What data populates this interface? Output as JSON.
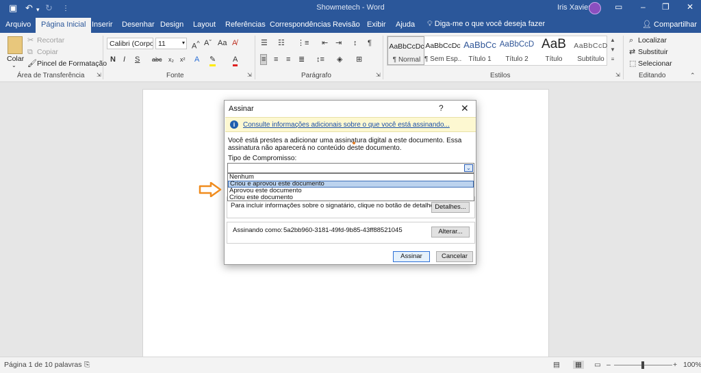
{
  "titlebar": {
    "title": "Showmetech - Word",
    "user": "Iris Xavier",
    "save_icon": "save-icon",
    "undo_icon": "undo-icon",
    "redo_icon": "redo-icon",
    "color_bg": "#2b579a"
  },
  "menubar": {
    "tabs": [
      "Arquivo",
      "Página Inicial",
      "Inserir",
      "Desenhar",
      "Design",
      "Layout",
      "Referências",
      "Correspondências",
      "Revisão",
      "Exibir",
      "Ajuda"
    ],
    "tellme": "Diga-me o que você deseja fazer",
    "share": "Compartilhar"
  },
  "ribbon": {
    "clipboard": {
      "paste": "Colar",
      "cut": "Recortar",
      "copy": "Copiar",
      "format_painter": "Pincel de Formatação",
      "group": "Área de Transferência"
    },
    "font": {
      "font_name": "Calibri (Corpo",
      "font_size": "11",
      "bold": "N",
      "italic": "I",
      "underline": "S",
      "strike": "abc",
      "group": "Fonte"
    },
    "paragraph": {
      "group": "Parágrafo"
    },
    "styles": {
      "items": [
        {
          "sample": "AaBbCcDc",
          "name": "¶ Normal"
        },
        {
          "sample": "AaBbCcDc",
          "name": "¶ Sem Esp..."
        },
        {
          "sample": "AaBbCc",
          "name": "Título 1"
        },
        {
          "sample": "AaBbCcD",
          "name": "Título 2"
        },
        {
          "sample": "AaB",
          "name": "Título"
        },
        {
          "sample": "AaBbCcD",
          "name": "Subtítulo"
        }
      ],
      "group": "Estilos"
    },
    "editing": {
      "find": "Localizar",
      "replace": "Substituir",
      "select": "Selecionar",
      "group": "Editando"
    }
  },
  "dialog": {
    "title": "Assinar",
    "help": "?",
    "close": "✕",
    "info_link": "Consulte informações adicionais sobre o que você está assinando...",
    "description": "Você está prestes a adicionar uma assinatura digital a este documento. Essa assinatura não aparecerá no conteúdo deste documento.",
    "commitment_label": "Tipo de Compromisso:",
    "commitment_value": "",
    "options": [
      "Nenhum",
      "Criou e aprovou este documento",
      "Aprovou este documento",
      "Criou este documento"
    ],
    "highlighted_option": 1,
    "details_text": "Para incluir informações sobre o signatário, clique no botão de detalhes.",
    "details_button": "Detalhes...",
    "signing_as_label": "Assinando como:",
    "signing_as_value": "5a2bb960-3181-49fd-9b85-43ff88521045",
    "change_button": "Alterar...",
    "sign_button": "Assinar",
    "cancel_button": "Cancelar"
  },
  "statusbar": {
    "page": "Página 1 de 1",
    "words": "0 palavras",
    "zoom": "100%"
  },
  "colors": {
    "accent": "#2b579a",
    "arrow": "#f08c1e"
  }
}
